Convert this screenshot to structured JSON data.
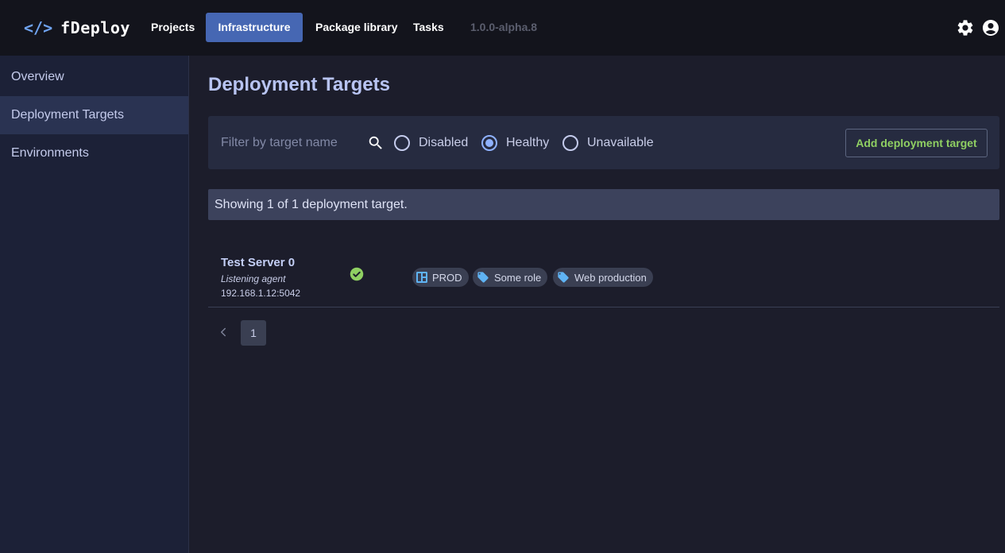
{
  "app": {
    "name": "fDeploy",
    "logo_glyph": "</>",
    "version": "1.0.0-alpha.8"
  },
  "nav": {
    "projects": "Projects",
    "infrastructure": "Infrastructure",
    "package_library": "Package library",
    "tasks": "Tasks",
    "active": "Infrastructure"
  },
  "sidebar": {
    "items": [
      {
        "label": "Overview"
      },
      {
        "label": "Deployment Targets"
      },
      {
        "label": "Environments"
      }
    ],
    "active": "Deployment Targets"
  },
  "page": {
    "title": "Deployment Targets"
  },
  "filter": {
    "placeholder": "Filter by target name",
    "value": "",
    "options": [
      {
        "label": "Disabled",
        "checked": false
      },
      {
        "label": "Healthy",
        "checked": true
      },
      {
        "label": "Unavailable",
        "checked": false
      }
    ],
    "add_button": "Add deployment target"
  },
  "summary": "Showing 1 of 1 deployment target.",
  "targets": [
    {
      "name": "Test Server 0",
      "type": "Listening agent",
      "address": "192.168.1.12:5042",
      "status": "healthy",
      "tags": [
        {
          "label": "PROD",
          "icon": "environment-icon"
        },
        {
          "label": "Some role",
          "icon": "tag-icon"
        },
        {
          "label": "Web production",
          "icon": "tag-icon"
        }
      ]
    }
  ],
  "pagination": {
    "current_page": "1"
  },
  "colors": {
    "accent": "#4667b3",
    "healthy": "#8fcf62",
    "link": "#8fb2ff"
  }
}
